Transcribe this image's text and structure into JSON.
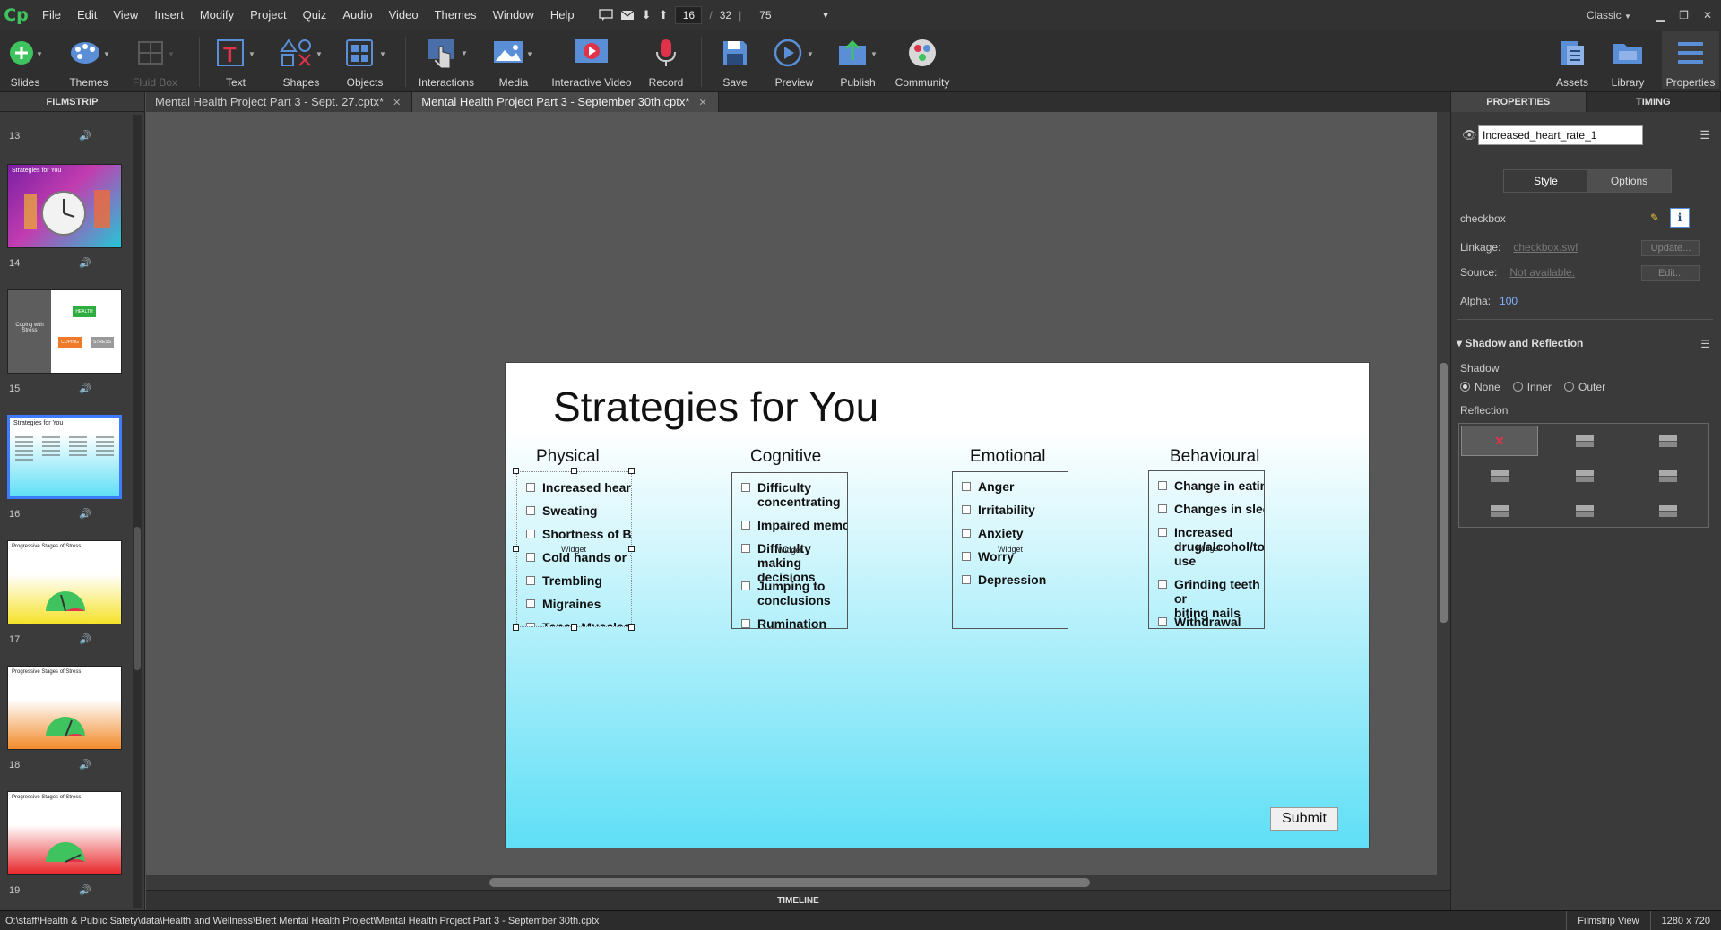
{
  "app": {
    "logo": "Cp",
    "menu": [
      "File",
      "Edit",
      "View",
      "Insert",
      "Modify",
      "Project",
      "Quiz",
      "Audio",
      "Video",
      "Themes",
      "Window",
      "Help"
    ],
    "slide_current": "16",
    "slide_separator": "/",
    "slide_total": "32",
    "zoom": "75",
    "workspace": "Classic"
  },
  "toolbar": {
    "slides": "Slides",
    "themes": "Themes",
    "fluid_box": "Fluid Box",
    "text": "Text",
    "shapes": "Shapes",
    "objects": "Objects",
    "interactions": "Interactions",
    "media": "Media",
    "interactive_video": "Interactive Video",
    "record": "Record",
    "save": "Save",
    "preview": "Preview",
    "publish": "Publish",
    "community": "Community",
    "assets": "Assets",
    "library": "Library",
    "properties": "Properties"
  },
  "filmstrip": {
    "title": "FILMSTRIP",
    "slides": [
      {
        "num": "13"
      },
      {
        "num": "14",
        "thumb_title": "Strategies for You"
      },
      {
        "num": "15",
        "thumb_title": "Coping with Stress",
        "nodes": [
          "HEALTH",
          "COPING",
          "STRESS"
        ]
      },
      {
        "num": "16",
        "thumb_title": "Strategies for You"
      },
      {
        "num": "17",
        "thumb_title": "Progressive Stages of Stress"
      },
      {
        "num": "18",
        "thumb_title": "Progressive Stages of Stress"
      },
      {
        "num": "19",
        "thumb_title": "Progressive Stages of Stress"
      }
    ]
  },
  "tabs": [
    {
      "label": "Mental Health Project Part 3 - Sept. 27.cptx*"
    },
    {
      "label": "Mental Health Project Part 3 - September 30th.cptx*"
    }
  ],
  "slide": {
    "title": "Strategies for You",
    "submit": "Submit",
    "widget_label": "Widget",
    "columns": [
      {
        "heading": "Physical",
        "items": [
          "Increased heart rate",
          "Sweating",
          "Shortness of Breath",
          "Cold hands or feet",
          "Trembling",
          "Migraines",
          "Tense Muscles"
        ]
      },
      {
        "heading": "Cognitive",
        "items": [
          "Difficulty\nconcentrating",
          "Impaired memory",
          "Difficulty making\ndecisions",
          "Jumping to\nconclusions",
          "Rumination"
        ]
      },
      {
        "heading": "Emotional",
        "items": [
          "Anger",
          "Irritability",
          "Anxiety",
          "Worry",
          "Depression"
        ]
      },
      {
        "heading": "Behavioural",
        "items": [
          "Change in eating",
          "Changes in sleep",
          "Increased\ndrug/alcohol/tobacco\nuse",
          "Grinding teeth or\nbiting nails",
          "Withdrawal"
        ]
      }
    ]
  },
  "timeline": {
    "label": "TIMELINE"
  },
  "properties": {
    "tab_properties": "PROPERTIES",
    "tab_timing": "TIMING",
    "object_name": "Increased_heart_rate_1",
    "style_tab": "Style",
    "options_tab": "Options",
    "widget_type": "checkbox",
    "linkage_label": "Linkage:",
    "linkage_value": "checkbox.swf",
    "update_btn": "Update...",
    "source_label": "Source:",
    "source_value": "Not available.",
    "edit_btn": "Edit...",
    "alpha_label": "Alpha:",
    "alpha_value": "100",
    "shadow_section": "Shadow and Reflection",
    "shadow_label": "Shadow",
    "shadow_none": "None",
    "shadow_inner": "Inner",
    "shadow_outer": "Outer",
    "reflection_label": "Reflection"
  },
  "status": {
    "path": "O:\\staff\\Health & Public Safety\\data\\Health and Wellness\\Brett Mental Health Project\\Mental Health Project Part 3 - September 30th.cptx",
    "view": "Filmstrip View",
    "size": "1280 x 720"
  },
  "colors": {
    "accent": "#3d7bff",
    "logo": "#3fc35f",
    "record": "#e0334a"
  }
}
